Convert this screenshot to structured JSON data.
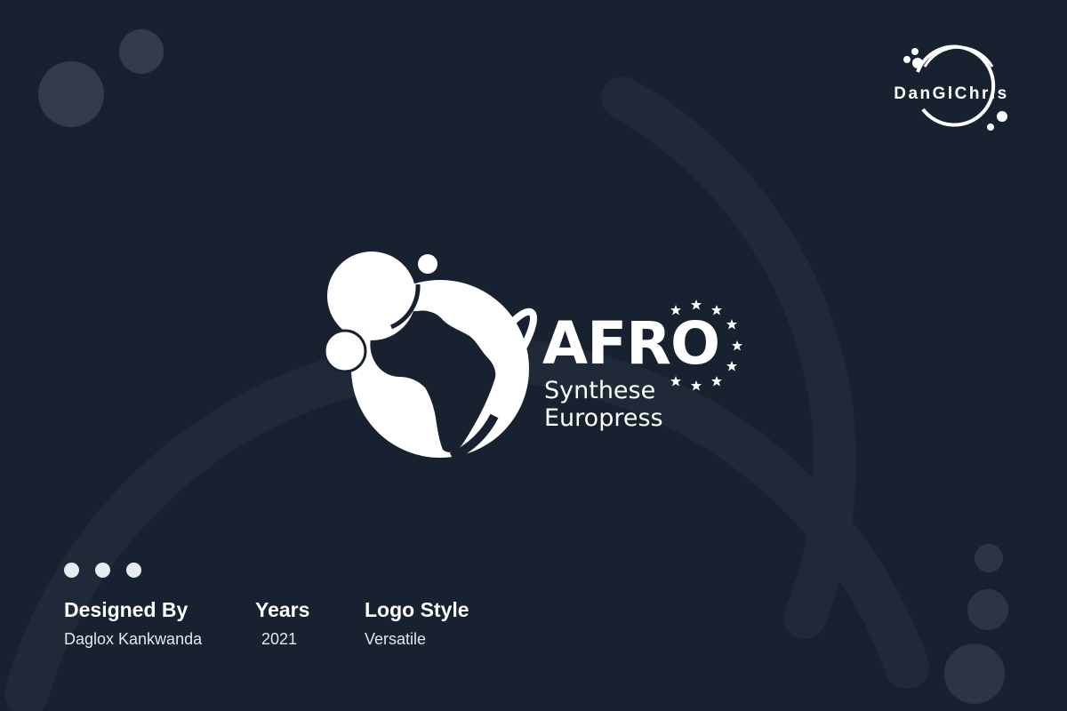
{
  "brand": {
    "name": "DanGlChris"
  },
  "logo": {
    "title": "AFRO",
    "line1": "Synthese",
    "line2": "Europress",
    "icon": "globe-africa-icon",
    "stars_icon": "star-ring-icon"
  },
  "dots_count": 3,
  "info": [
    {
      "heading": "Designed By",
      "value": "Daglox Kankwanda"
    },
    {
      "heading": "Years",
      "value": "2021"
    },
    {
      "heading": "Logo Style",
      "value": "Versatile"
    }
  ],
  "colors": {
    "background": "#182130",
    "decor": "#212b3a",
    "decor_circle": "#3a4456",
    "text": "#ffffff"
  }
}
